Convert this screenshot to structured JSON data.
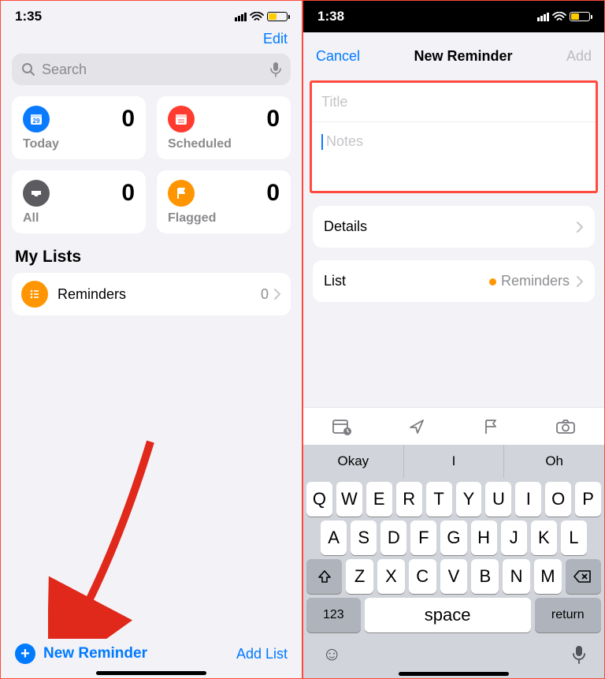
{
  "left": {
    "status": {
      "time": "1:35"
    },
    "edit": "Edit",
    "search_placeholder": "Search",
    "tiles": {
      "today": {
        "label": "Today",
        "count": "0"
      },
      "scheduled": {
        "label": "Scheduled",
        "count": "0"
      },
      "all": {
        "label": "All",
        "count": "0"
      },
      "flagged": {
        "label": "Flagged",
        "count": "0"
      }
    },
    "section": "My Lists",
    "list": {
      "name": "Reminders",
      "count": "0"
    },
    "new_reminder": "New Reminder",
    "add_list": "Add List"
  },
  "right": {
    "status": {
      "time": "1:38"
    },
    "modal": {
      "cancel": "Cancel",
      "title": "New Reminder",
      "add": "Add",
      "title_placeholder": "Title",
      "notes_placeholder": "Notes",
      "details": "Details",
      "list_label": "List",
      "list_value": "Reminders"
    },
    "suggestions": [
      "Okay",
      "I",
      "Oh"
    ],
    "keys": {
      "row1": [
        "Q",
        "W",
        "E",
        "R",
        "T",
        "Y",
        "U",
        "I",
        "O",
        "P"
      ],
      "row2": [
        "A",
        "S",
        "D",
        "F",
        "G",
        "H",
        "J",
        "K",
        "L"
      ],
      "row3": [
        "Z",
        "X",
        "C",
        "V",
        "B",
        "N",
        "M"
      ],
      "num": "123",
      "space": "space",
      "ret": "return"
    }
  }
}
